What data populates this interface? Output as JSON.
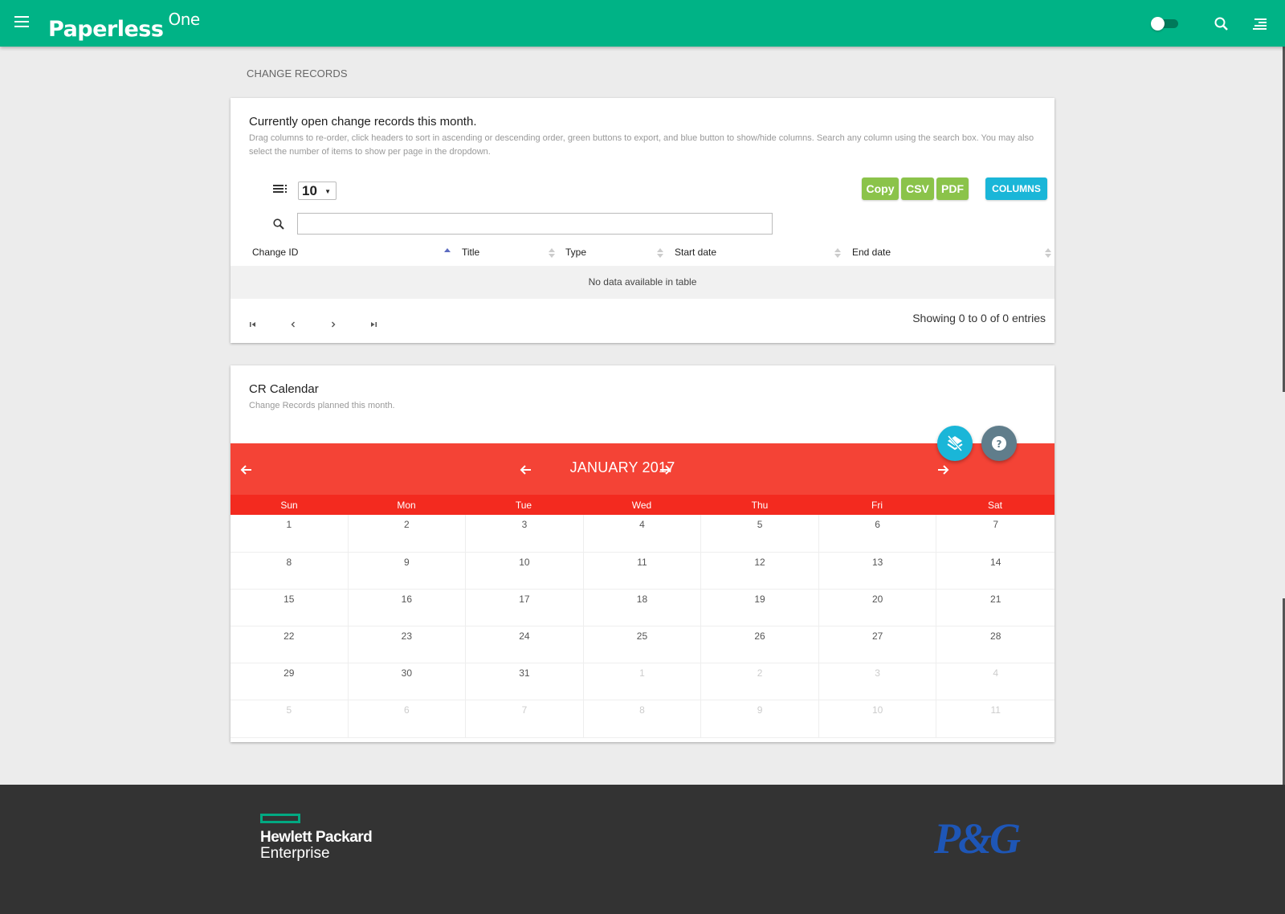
{
  "app": {
    "brand": "Paperless",
    "brand_suffix": "One"
  },
  "breadcrumb": "CHANGE RECORDS",
  "records_card": {
    "title": "Currently open change records this month.",
    "description": "Drag columns to re-order, click headers to sort in ascending or descending order, green buttons to export, and blue button to show/hide columns. Search any column using the search box. You may also select the number of items to show per page in the dropdown.",
    "page_length": "10",
    "search": {
      "value": "",
      "placeholder": ""
    },
    "buttons": {
      "copy": "Copy",
      "csv": "CSV",
      "pdf": "PDF",
      "columns": "COLUMNS"
    },
    "columns": [
      "Change ID",
      "Title",
      "Type",
      "Start date",
      "End date"
    ],
    "empty_message": "No data available in table",
    "showing": "Showing 0 to 0 of 0 entries"
  },
  "calendar_card": {
    "title": "CR Calendar",
    "description": "Change Records planned this month.",
    "month_label": "JANUARY 2017",
    "weekdays": [
      "Sun",
      "Mon",
      "Tue",
      "Wed",
      "Thu",
      "Fri",
      "Sat"
    ],
    "weeks": [
      [
        "1",
        "2",
        "3",
        "4",
        "5",
        "6",
        "7"
      ],
      [
        "8",
        "9",
        "10",
        "11",
        "12",
        "13",
        "14"
      ],
      [
        "15",
        "16",
        "17",
        "18",
        "19",
        "20",
        "21"
      ],
      [
        "22",
        "23",
        "24",
        "25",
        "26",
        "27",
        "28"
      ],
      [
        "29",
        "30",
        "31",
        "1",
        "2",
        "3",
        "4"
      ],
      [
        "5",
        "6",
        "7",
        "8",
        "9",
        "10",
        "11"
      ]
    ],
    "other_month_from": {
      "week": 4,
      "day": 3
    }
  },
  "footer": {
    "hpe_line1": "Hewlett Packard",
    "hpe_line2": "Enterprise",
    "pg": "P&G"
  },
  "colors": {
    "topbar": "#00b386",
    "calendar_header": "#f44336",
    "weekday_bar": "#f32a1f",
    "export_green": "#8bc34a",
    "columns_blue": "#1ab6d8",
    "footer": "#333333"
  },
  "icons": {
    "topbar": [
      "menu-icon",
      "toggle-switch",
      "search-icon",
      "list-icon"
    ],
    "table": [
      "page-length-icon",
      "search-icon",
      "first-page-icon",
      "previous-page-icon",
      "next-page-icon",
      "last-page-icon"
    ],
    "calendar": [
      "arrow-left-icon",
      "arrow-right-icon",
      "layers-off-icon",
      "help-icon"
    ]
  }
}
